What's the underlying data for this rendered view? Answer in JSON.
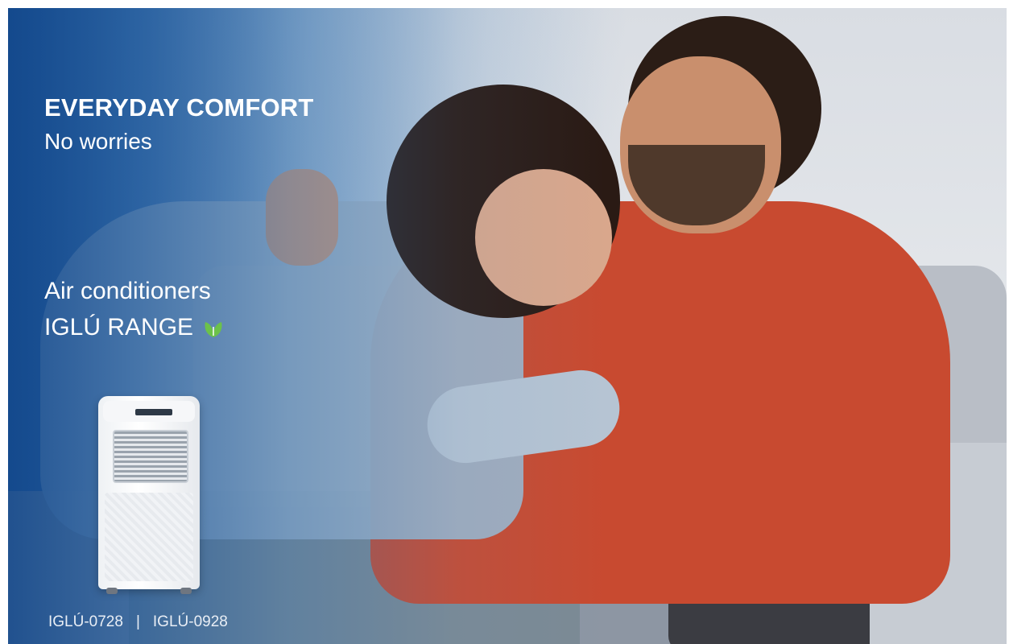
{
  "headline": "EVERYDAY COMFORT",
  "subline": "No worries",
  "product_type": "Air conditioners",
  "range_name": "IGLÚ RANGE",
  "model_a": "IGLÚ-0728",
  "separator": "|",
  "model_b": "IGLÚ-0928",
  "colors": {
    "overlay_blue": "#124b8c",
    "leaf_green": "#6cc24a",
    "text": "#ffffff"
  },
  "icons": {
    "brand_leaf": "leaf-icon"
  }
}
